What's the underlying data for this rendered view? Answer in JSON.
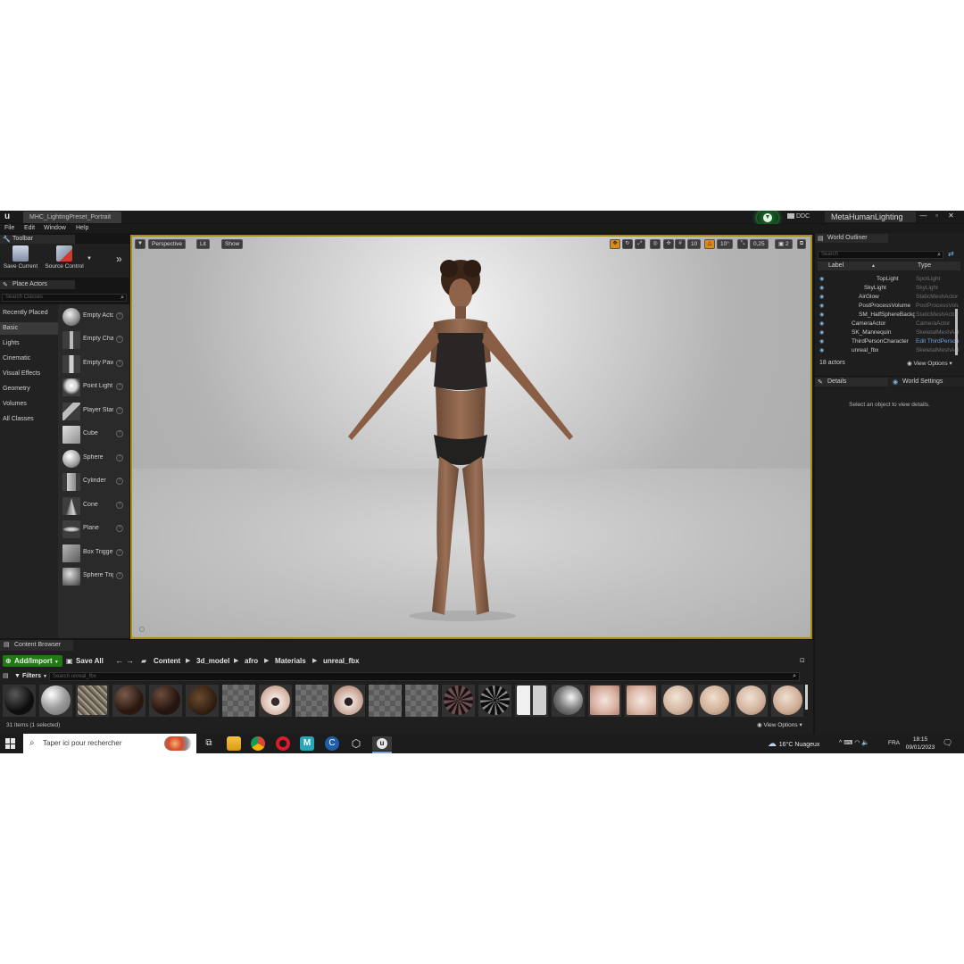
{
  "window": {
    "doc_tab": "MHC_LightingPreset_Portrait",
    "ddc": "DDC",
    "project_name": "MetaHumanLighting",
    "controls": [
      "—",
      "▫",
      "✕"
    ]
  },
  "menu": [
    "File",
    "Edit",
    "Window",
    "Help"
  ],
  "toolbar": {
    "tab": "Toolbar",
    "save_current": "Save Current",
    "source_control": "Source Control"
  },
  "place_actors": {
    "tab": "Place Actors",
    "search_placeholder": "Search Classes",
    "categories": [
      "Recently Placed",
      "Basic",
      "Lights",
      "Cinematic",
      "Visual Effects",
      "Geometry",
      "Volumes",
      "All Classes"
    ],
    "active_category": "Basic",
    "items": [
      "Empty Actor",
      "Empty Character",
      "Empty Pawn",
      "Point Light",
      "Player Start",
      "Cube",
      "Sphere",
      "Cylinder",
      "Cone",
      "Plane",
      "Box Trigger",
      "Sphere Trigger"
    ]
  },
  "viewport": {
    "perspective": "Perspective",
    "lit": "Lit",
    "show": "Show",
    "grid_snap": "10",
    "rot_snap": "10°",
    "scale_snap": "0,25",
    "camera_speed": "2"
  },
  "outliner": {
    "tab": "World Outliner",
    "search_placeholder": "Search",
    "col_label": "Label",
    "col_type": "Type",
    "rows": [
      {
        "name": "TopLight",
        "type": "SpotLight",
        "indent": 3
      },
      {
        "name": "SkyLight",
        "type": "SkyLight",
        "indent": 2
      },
      {
        "name": "AirGlow",
        "type": "StaticMeshActor",
        "indent": 1
      },
      {
        "name": "PostProcessVolume",
        "type": "PostProcessVolume",
        "indent": 1
      },
      {
        "name": "SM_HalfSphereBackground",
        "type": "StaticMeshActor",
        "indent": 1
      },
      {
        "name": "CameraActor",
        "type": "CameraActor",
        "indent": 0
      },
      {
        "name": "SK_Mannequin",
        "type": "SkeletalMeshActor",
        "indent": 0
      },
      {
        "name": "ThirdPersonCharacter",
        "type": "Edit ThirdPersonCharacter",
        "indent": 0,
        "link": true
      },
      {
        "name": "unreal_fbx",
        "type": "SkeletalMeshActor",
        "indent": 0
      }
    ],
    "actor_count": "18 actors",
    "view_options": "View Options"
  },
  "details": {
    "tab": "Details",
    "world_settings_tab": "World Settings",
    "empty_message": "Select an object to view details."
  },
  "content_browser": {
    "tab": "Content Browser",
    "add_import": "Add/Import",
    "save_all": "Save All",
    "breadcrumb": [
      "Content",
      "3d_model",
      "afro",
      "Materials",
      "unreal_fbx"
    ],
    "filters": "Filters",
    "search_placeholder": "Search unreal_fbx",
    "item_count": "31 items (1 selected)",
    "view_options": "View Options"
  },
  "taskbar": {
    "search_placeholder": "Taper ici pour rechercher",
    "weather": "16°C  Nuageux",
    "language": "FRA",
    "time": "18:15",
    "date": "09/01/2023"
  }
}
